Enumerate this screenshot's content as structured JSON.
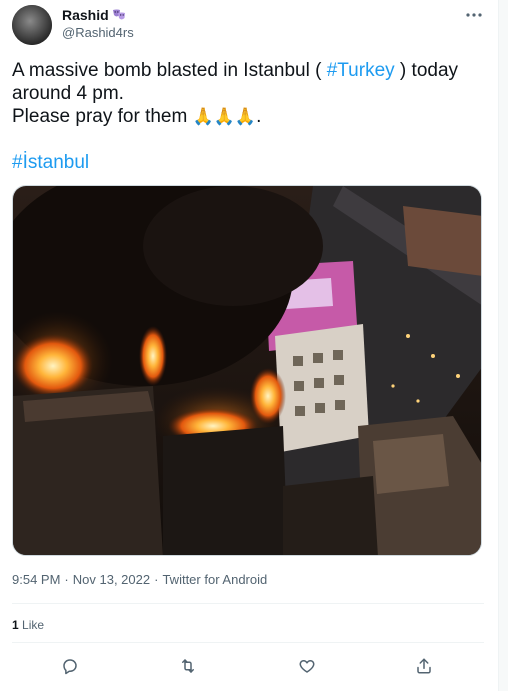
{
  "author": {
    "display_name": "Rashid",
    "handle": "@Rashid4rs",
    "badge_icon": "theater-masks-icon"
  },
  "tweet": {
    "line1_pre": "A massive bomb blasted in Istanbul ( ",
    "line1_hashtag": "#Turkey",
    "line1_post": " ) today",
    "line2": "around 4 pm.",
    "line3": "Please pray for them",
    "line3_emoji": "🙏🙏🙏",
    "line3_post": ".",
    "hashtag": "#İstanbul"
  },
  "media": {
    "image_icon": "photo-fire-night-icon"
  },
  "meta": {
    "time": "9:54 PM",
    "sep1": "·",
    "date": "Nov 13, 2022",
    "sep2": "·",
    "source": "Twitter for Android"
  },
  "stats": {
    "likes_count": "1",
    "likes_label": "Like"
  },
  "actions": {
    "reply_icon": "reply-icon",
    "retweet_icon": "retweet-icon",
    "like_icon": "heart-icon",
    "share_icon": "share-icon"
  },
  "colors": {
    "link": "#1d9bf0",
    "text": "#0f1419",
    "muted": "#536471",
    "divider": "#eff3f4"
  }
}
